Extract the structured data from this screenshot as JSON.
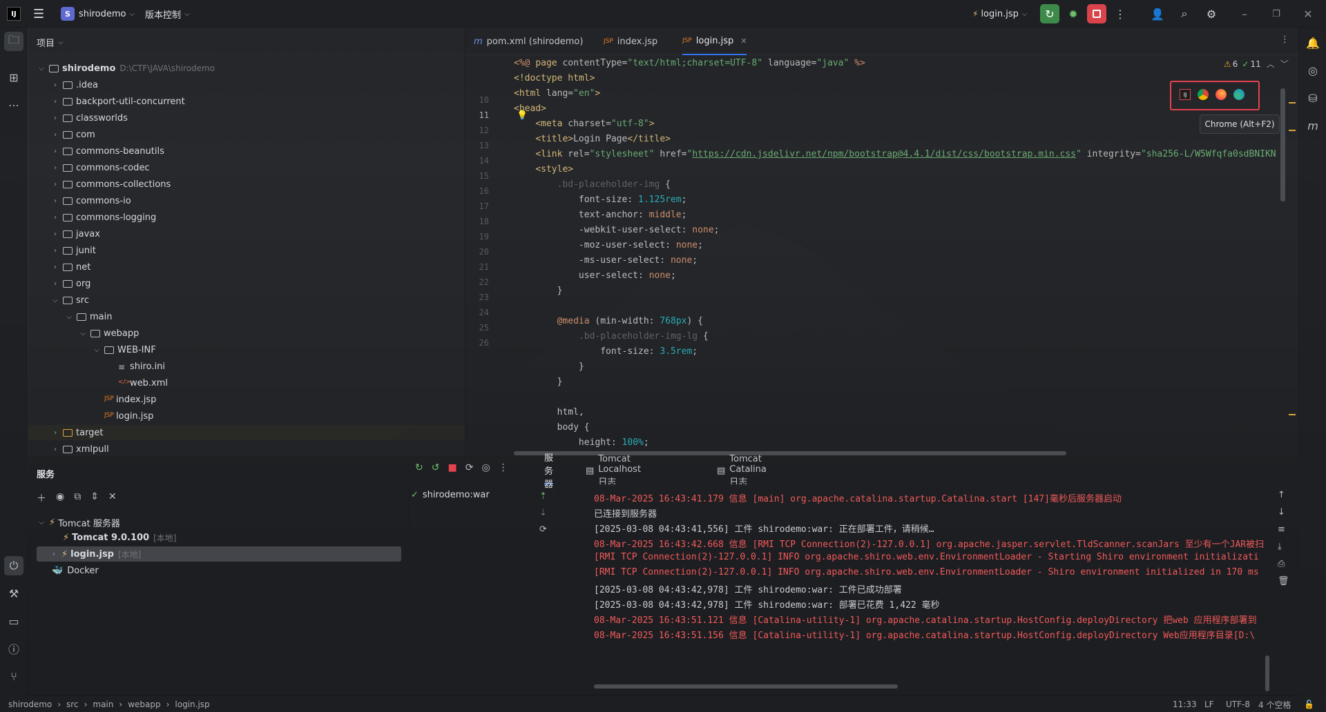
{
  "titlebar": {
    "project": "shirodemo",
    "vcs": "版本控制",
    "run_config": "login.jsp"
  },
  "project_panel": {
    "title": "项目",
    "root": {
      "name": "shirodemo",
      "path": "D:\\CTF\\JAVA\\shirodemo"
    },
    "items": [
      {
        "name": ".idea",
        "indent": 1
      },
      {
        "name": "backport-util-concurrent",
        "indent": 1
      },
      {
        "name": "classworlds",
        "indent": 1
      },
      {
        "name": "com",
        "indent": 1
      },
      {
        "name": "commons-beanutils",
        "indent": 1
      },
      {
        "name": "commons-codec",
        "indent": 1
      },
      {
        "name": "commons-collections",
        "indent": 1
      },
      {
        "name": "commons-io",
        "indent": 1
      },
      {
        "name": "commons-logging",
        "indent": 1
      },
      {
        "name": "javax",
        "indent": 1
      },
      {
        "name": "junit",
        "indent": 1
      },
      {
        "name": "net",
        "indent": 1
      },
      {
        "name": "org",
        "indent": 1
      },
      {
        "name": "src",
        "indent": 1
      },
      {
        "name": "main",
        "indent": 2
      },
      {
        "name": "webapp",
        "indent": 3
      },
      {
        "name": "WEB-INF",
        "indent": 4
      },
      {
        "name": "shiro.ini",
        "indent": 5
      },
      {
        "name": "web.xml",
        "indent": 5
      },
      {
        "name": "index.jsp",
        "indent": 4
      },
      {
        "name": "login.jsp",
        "indent": 4
      },
      {
        "name": "target",
        "indent": 1
      },
      {
        "name": "xmlpull",
        "indent": 1
      }
    ]
  },
  "editor": {
    "tabs": [
      {
        "label": "pom.xml (shirodemo)"
      },
      {
        "label": "index.jsp"
      },
      {
        "label": "login.jsp"
      }
    ],
    "warnings": "6",
    "checks": "11",
    "tooltip": "Chrome (Alt+F2)",
    "current_line": "11"
  },
  "services": {
    "title": "服务",
    "tree": {
      "tomcat_server": "Tomcat 服务器",
      "tomcat_version": "Tomcat 9.0.100",
      "local": "[本地]",
      "login": "login.jsp",
      "docker": "Docker"
    },
    "deployment": "shirodemo:war",
    "tabs": [
      "服务器",
      "Tomcat Localhost 日志",
      "Tomcat Catalina 日志"
    ],
    "log": [
      {
        "text": "08-Mar-2025 16:43:41.179 信息 [main] org.apache.catalina.startup.Catalina.start [147]毫秒后服务器启动",
        "color": "red"
      },
      {
        "text": "已连接到服务器",
        "color": "white"
      },
      {
        "text": "[2025-03-08 04:43:41,556] 工件 shirodemo:war: 正在部署工件，请稍候…",
        "color": "white"
      },
      {
        "text": "08-Mar-2025 16:43:42.668 信息 [RMI TCP Connection(2)-127.0.0.1] org.apache.jasper.servlet.TldScanner.scanJars 至少有一个JAR被扫",
        "color": "red"
      },
      {
        "text": "[RMI TCP Connection(2)-127.0.0.1] INFO org.apache.shiro.web.env.EnvironmentLoader - Starting Shiro environment initializati",
        "color": "red"
      },
      {
        "text": "[RMI TCP Connection(2)-127.0.0.1] INFO org.apache.shiro.web.env.EnvironmentLoader - Shiro environment initialized in 170 ms",
        "color": "red"
      },
      {
        "text": "[2025-03-08 04:43:42,978] 工件 shirodemo:war: 工件已成功部署",
        "color": "white"
      },
      {
        "text": "[2025-03-08 04:43:42,978] 工件 shirodemo:war: 部署已花费 1,422 毫秒",
        "color": "white"
      },
      {
        "text": "08-Mar-2025 16:43:51.121 信息 [Catalina-utility-1] org.apache.catalina.startup.HostConfig.deployDirectory 把web 应用程序部署到",
        "color": "red"
      },
      {
        "text": "08-Mar-2025 16:43:51.156 信息 [Catalina-utility-1] org.apache.catalina.startup.HostConfig.deployDirectory Web应用程序目录[D:\\",
        "color": "red"
      }
    ]
  },
  "statusbar": {
    "breadcrumb": [
      "shirodemo",
      "src",
      "main",
      "webapp",
      "login.jsp"
    ],
    "position": "11:33",
    "line_sep": "LF",
    "encoding": "UTF-8",
    "indent": "4 个空格"
  }
}
